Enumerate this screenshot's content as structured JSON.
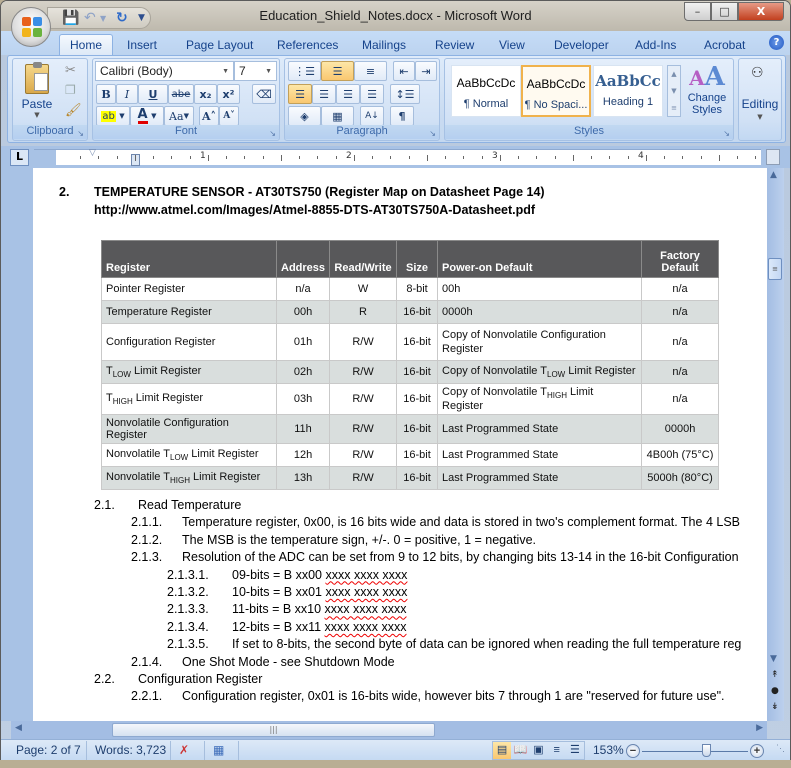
{
  "window": {
    "title": "Education_Shield_Notes.docx - Microsoft Word",
    "controls": {
      "minimize": "–",
      "maximize": "□",
      "close": "X"
    }
  },
  "quick_access": {
    "icons": [
      "save-icon",
      "undo-icon",
      "redo-icon",
      "customize-icon"
    ]
  },
  "tabs": [
    {
      "label": "Home",
      "active": true
    },
    {
      "label": "Insert"
    },
    {
      "label": "Page Layout"
    },
    {
      "label": "References"
    },
    {
      "label": "Mailings"
    },
    {
      "label": "Review"
    },
    {
      "label": "View"
    },
    {
      "label": "Developer"
    },
    {
      "label": "Add-Ins"
    },
    {
      "label": "Acrobat"
    }
  ],
  "ribbon": {
    "clipboard": {
      "label": "Clipboard",
      "paste": "Paste"
    },
    "font": {
      "label": "Font",
      "font_name": "Calibri (Body)",
      "font_size": "7",
      "bold": "B",
      "italic": "I",
      "underline": "U",
      "strike": "abe",
      "subscript": "x₂",
      "superscript": "x²",
      "change_case": "Aa",
      "grow": "A˄",
      "shrink": "A˅",
      "highlight": "ab",
      "font_color": "A",
      "font_color_hex": "#e00000"
    },
    "paragraph": {
      "label": "Paragraph",
      "pilcrow": "¶"
    },
    "styles": {
      "label": "Styles",
      "items": [
        {
          "sample": "AaBbCcDc",
          "name": "¶ Normal"
        },
        {
          "sample": "AaBbCcDc",
          "name": "¶ No Spaci...",
          "selected": true
        },
        {
          "sample": "AaBbCc",
          "name": "Heading 1"
        }
      ],
      "change_styles": "Change Styles"
    },
    "editing": {
      "label": "Editing"
    }
  },
  "ruler": {
    "numbers": [
      "1",
      "2",
      "3",
      "4"
    ]
  },
  "document": {
    "heading_num": "2.",
    "heading": "TEMPERATURE SENSOR - AT30TS750 (Register Map on Datasheet Page 14)",
    "url": "http://www.atmel.com/Images/Atmel-8855-DTS-AT30TS750A-Datasheet.pdf",
    "table": {
      "headers": [
        "Register",
        "Address",
        "Read/Write",
        "Size",
        "Power-on Default",
        "Factory Default"
      ],
      "rows": [
        {
          "register": "Pointer Register",
          "address": "n/a",
          "rw": "W",
          "size": "8-bit",
          "default": "00h",
          "factory": "n/a"
        },
        {
          "register": "Temperature Register",
          "address": "00h",
          "rw": "R",
          "size": "16-bit",
          "default": "0000h",
          "factory": "n/a"
        },
        {
          "register": "Configuration Register",
          "address": "01h",
          "rw": "R/W",
          "size": "16-bit",
          "default": "Copy of Nonvolatile Configuration Register",
          "factory": "n/a"
        },
        {
          "register_pre": "T",
          "register_sub": "LOW",
          "register_post": " Limit Register",
          "address": "02h",
          "rw": "R/W",
          "size": "16-bit",
          "default_pre": "Copy of Nonvolatile T",
          "default_sub": "LOW",
          "default_post": " Limit Register",
          "factory": "n/a"
        },
        {
          "register_pre": "T",
          "register_sub": "HIGH",
          "register_post": " Limit Register",
          "address": "03h",
          "rw": "R/W",
          "size": "16-bit",
          "default_pre": "Copy of Nonvolatile T",
          "default_sub": "HIGH",
          "default_post": " Limit Register",
          "factory": "n/a"
        },
        {
          "register": "Nonvolatile Configuration Register",
          "address": "11h",
          "rw": "R/W",
          "size": "16-bit",
          "default": "Last Programmed State",
          "factory": "0000h"
        },
        {
          "register_pre": "Nonvolatile T",
          "register_sub": "LOW",
          "register_post": " Limit Register",
          "address": "12h",
          "rw": "R/W",
          "size": "16-bit",
          "default": "Last Programmed State",
          "factory": "4B00h (75°C)"
        },
        {
          "register_pre": "Nonvolatile T",
          "register_sub": "HIGH",
          "register_post": " Limit Register",
          "address": "13h",
          "rw": "R/W",
          "size": "16-bit",
          "default": "Last Programmed State",
          "factory": "5000h (80°C)"
        }
      ]
    },
    "outline": [
      {
        "num": "2.1.",
        "text": "Read Temperature",
        "level": 1
      },
      {
        "num": "2.1.1.",
        "text": "Temperature register, 0x00, is 16 bits wide and data is stored in two's complement  format.  The 4 LSB",
        "level": 2
      },
      {
        "num": "2.1.2.",
        "text": "The MSB is the temperature  sign, +/-. 0 = positive,  1 = negative.",
        "level": 2
      },
      {
        "num": "2.1.3.",
        "text": "Resolution of the ADC can be set from 9 to 12 bits, by changing  bits 13-14 in the 16-bit  Configuration",
        "level": 2
      },
      {
        "num": "2.1.3.1.",
        "text": "09-bits = B xx00",
        "tail": "xxxx xxxx xxxx",
        "level": 3
      },
      {
        "num": "2.1.3.2.",
        "text": "10-bits = B xx01",
        "tail": "xxxx xxxx xxxx",
        "level": 3
      },
      {
        "num": "2.1.3.3.",
        "text": "11-bits = B xx10",
        "tail": "xxxx xxxx xxxx",
        "level": 3
      },
      {
        "num": "2.1.3.4.",
        "text": "12-bits = B xx11",
        "tail": "xxxx xxxx xxxx",
        "level": 3
      },
      {
        "num": "2.1.3.5.",
        "text": "If set to 8-bits, the second byte of data can be ignored when reading  the full temperature reg",
        "level": 3
      },
      {
        "num": "2.1.4.",
        "text": "One Shot  Mode  - see Shutdown  Mode",
        "level": 2
      },
      {
        "num": "2.2.",
        "text": "Configuration  Register",
        "level": 1
      },
      {
        "num": "2.2.1.",
        "text": "Configuration  register, 0x01 is 16-bits  wide, however  bits 7 through 1 are \"reserved for future use\".",
        "level": 2
      }
    ]
  },
  "statusbar": {
    "page": "Page: 2 of 7",
    "words": "Words: 3,723",
    "zoom": "153%",
    "zoom_fraction": 0.6
  },
  "colors": {
    "table_header_bg": "#58585a",
    "table_alt_row": "#d9dedd",
    "ribbon_text": "#15428b",
    "selected_style_border": "#f0b24c"
  }
}
